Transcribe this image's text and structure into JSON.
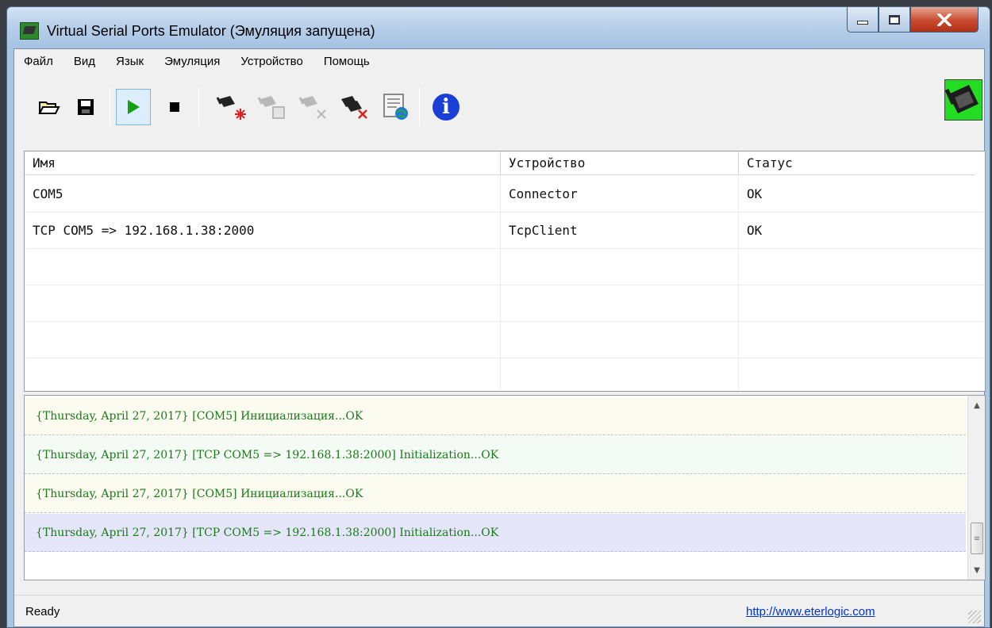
{
  "window": {
    "title": "Virtual Serial Ports Emulator (Эмуляция запущена)"
  },
  "menu": [
    "Файл",
    "Вид",
    "Язык",
    "Эмуляция",
    "Устройство",
    "Помощь"
  ],
  "toolbar": {
    "icons": [
      "open-folder-icon",
      "save-disk-icon",
      "play-icon",
      "stop-icon",
      "add-device-icon",
      "edit-device-icon",
      "remove-device-icon",
      "remove-all-devices-icon",
      "network-settings-icon",
      "info-icon"
    ],
    "info_glyph": "i",
    "active_button": "play"
  },
  "grid": {
    "columns": [
      "Имя",
      "Устройство",
      "Статус"
    ],
    "rows": [
      [
        "COM5",
        "Connector",
        "OK"
      ],
      [
        "TCP COM5 => 192.168.1.38:2000",
        "TcpClient",
        "OK"
      ]
    ]
  },
  "log": {
    "lines": [
      "{Thursday, April 27, 2017} [COM5] Инициализация...OK",
      "{Thursday, April 27, 2017} [TCP COM5 => 192.168.1.38:2000] Initialization...OK",
      "{Thursday, April 27, 2017} [COM5] Инициализация...OK",
      "{Thursday, April 27, 2017} [TCP COM5 => 192.168.1.38:2000] Initialization...OK"
    ],
    "text_color": "#1a7a1a"
  },
  "statusbar": {
    "text": "Ready",
    "link": "http://www.eterlogic.com"
  },
  "colors": {
    "accent_green": "#22dd22",
    "play_green": "#14a014",
    "info_blue": "#1a3fd6"
  }
}
